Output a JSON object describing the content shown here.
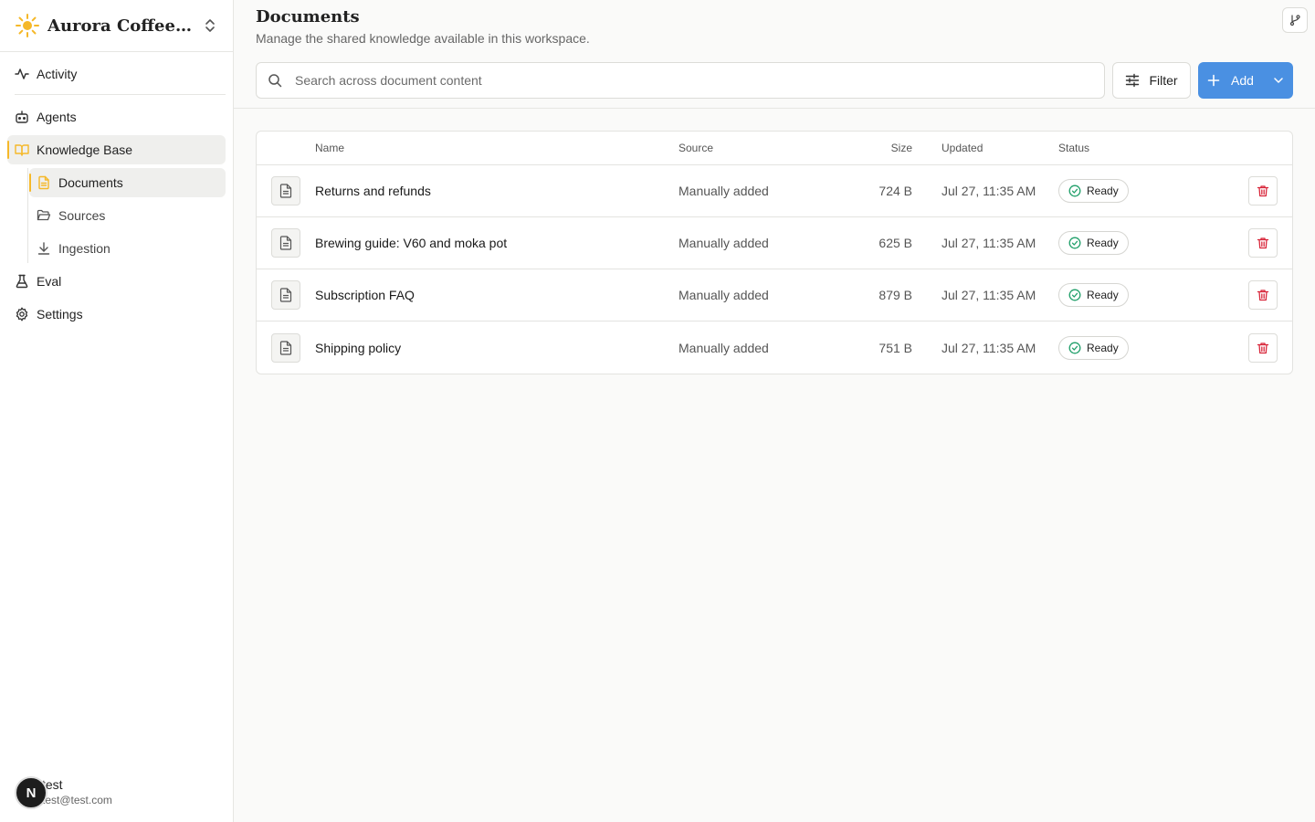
{
  "workspace": {
    "name": "Aurora Coffee Roasters",
    "logo_icon": "sun-icon",
    "accent": "#f5b829"
  },
  "sidebar": {
    "items": [
      {
        "label": "Activity",
        "icon": "activity-icon"
      },
      {
        "label": "Agents",
        "icon": "bot-icon"
      },
      {
        "label": "Knowledge Base",
        "icon": "book-icon"
      },
      {
        "label": "Documents",
        "icon": "document-icon"
      },
      {
        "label": "Sources",
        "icon": "folder-icon"
      },
      {
        "label": "Ingestion",
        "icon": "download-icon"
      },
      {
        "label": "Eval",
        "icon": "flask-icon"
      },
      {
        "label": "Settings",
        "icon": "gear-icon"
      }
    ]
  },
  "user": {
    "initial": "N",
    "name": "test",
    "email": "test@test.com"
  },
  "page": {
    "title": "Documents",
    "subtitle": "Manage the shared knowledge available in this workspace."
  },
  "search": {
    "placeholder": "Search across document content",
    "value": ""
  },
  "toolbar": {
    "filter_label": "Filter",
    "add_label": "Add",
    "add_color": "#4a90e2"
  },
  "table": {
    "headers": {
      "name": "Name",
      "source": "Source",
      "size": "Size",
      "updated": "Updated",
      "status": "Status"
    },
    "rows": [
      {
        "name": "Returns and refunds",
        "source": "Manually added",
        "size": "724 B",
        "updated": "Jul 27, 11:35 AM",
        "status": "Ready"
      },
      {
        "name": "Brewing guide: V60 and moka pot",
        "source": "Manually added",
        "size": "625 B",
        "updated": "Jul 27, 11:35 AM",
        "status": "Ready"
      },
      {
        "name": "Subscription FAQ",
        "source": "Manually added",
        "size": "879 B",
        "updated": "Jul 27, 11:35 AM",
        "status": "Ready"
      },
      {
        "name": "Shipping policy",
        "source": "Manually added",
        "size": "751 B",
        "updated": "Jul 27, 11:35 AM",
        "status": "Ready"
      }
    ]
  },
  "colors": {
    "status_ready": "#22a06b",
    "delete": "#d8263a"
  }
}
